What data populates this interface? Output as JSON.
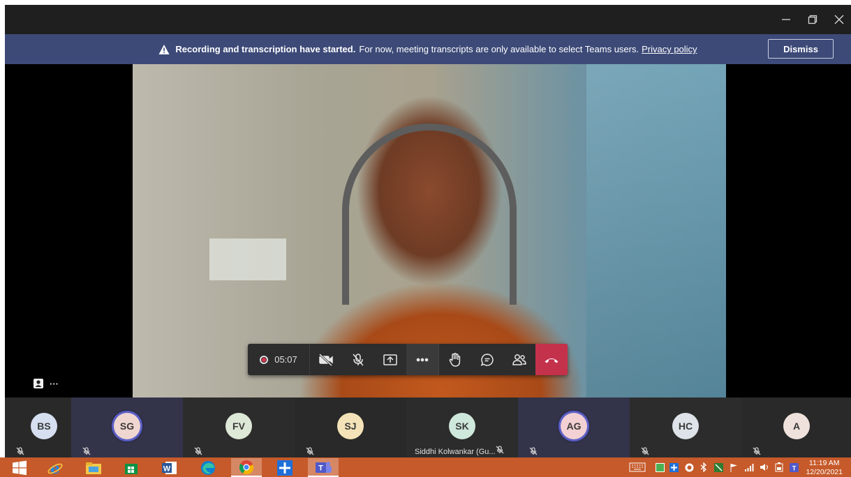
{
  "window": {
    "controls": [
      "minimize-icon",
      "restore-icon",
      "close-icon"
    ]
  },
  "banner": {
    "bold_text": "Recording and transcription have started.",
    "text": "For now, meeting transcripts are only available to select Teams users.",
    "link": "Privacy policy",
    "dismiss_label": "Dismiss",
    "color": "#3d4a78"
  },
  "controls": {
    "timer": "05:07",
    "recording_color": "#e0334e",
    "hangup_color": "#c4314b",
    "buttons": [
      "camera-off-icon",
      "mic-off-icon",
      "share-icon",
      "more-icon",
      "raise-hand-icon",
      "chat-icon",
      "participants-icon",
      "hang-up-icon"
    ]
  },
  "self_view": {
    "more": "···"
  },
  "participants": [
    {
      "initials": "BS",
      "color": "#d5dff0",
      "active": false,
      "name": ""
    },
    {
      "initials": "SG",
      "color": "#f0d6d0",
      "active": true,
      "name": ""
    },
    {
      "initials": "FV",
      "color": "#dde8d6",
      "active": false,
      "name": ""
    },
    {
      "initials": "SJ",
      "color": "#f4e3b8",
      "active": false,
      "name": ""
    },
    {
      "initials": "SK",
      "color": "#cfe8dc",
      "active": false,
      "name": "Siddhi Kolwankar (Gu..."
    },
    {
      "initials": "AG",
      "color": "#f3d0d3",
      "active": true,
      "name": ""
    },
    {
      "initials": "HC",
      "color": "#dde3e8",
      "active": false,
      "name": ""
    },
    {
      "initials": "A",
      "color": "#efe2dc",
      "active": false,
      "name": ""
    }
  ],
  "taskbar": {
    "apps": [
      "windows-start-icon",
      "internet-explorer-icon",
      "file-explorer-icon",
      "store-icon",
      "word-icon",
      "edge-icon",
      "chrome-icon",
      "plus-app-icon",
      "teams-icon"
    ],
    "time": "11:19 AM",
    "date": "12/20/2021",
    "color": "#c65a2a"
  }
}
